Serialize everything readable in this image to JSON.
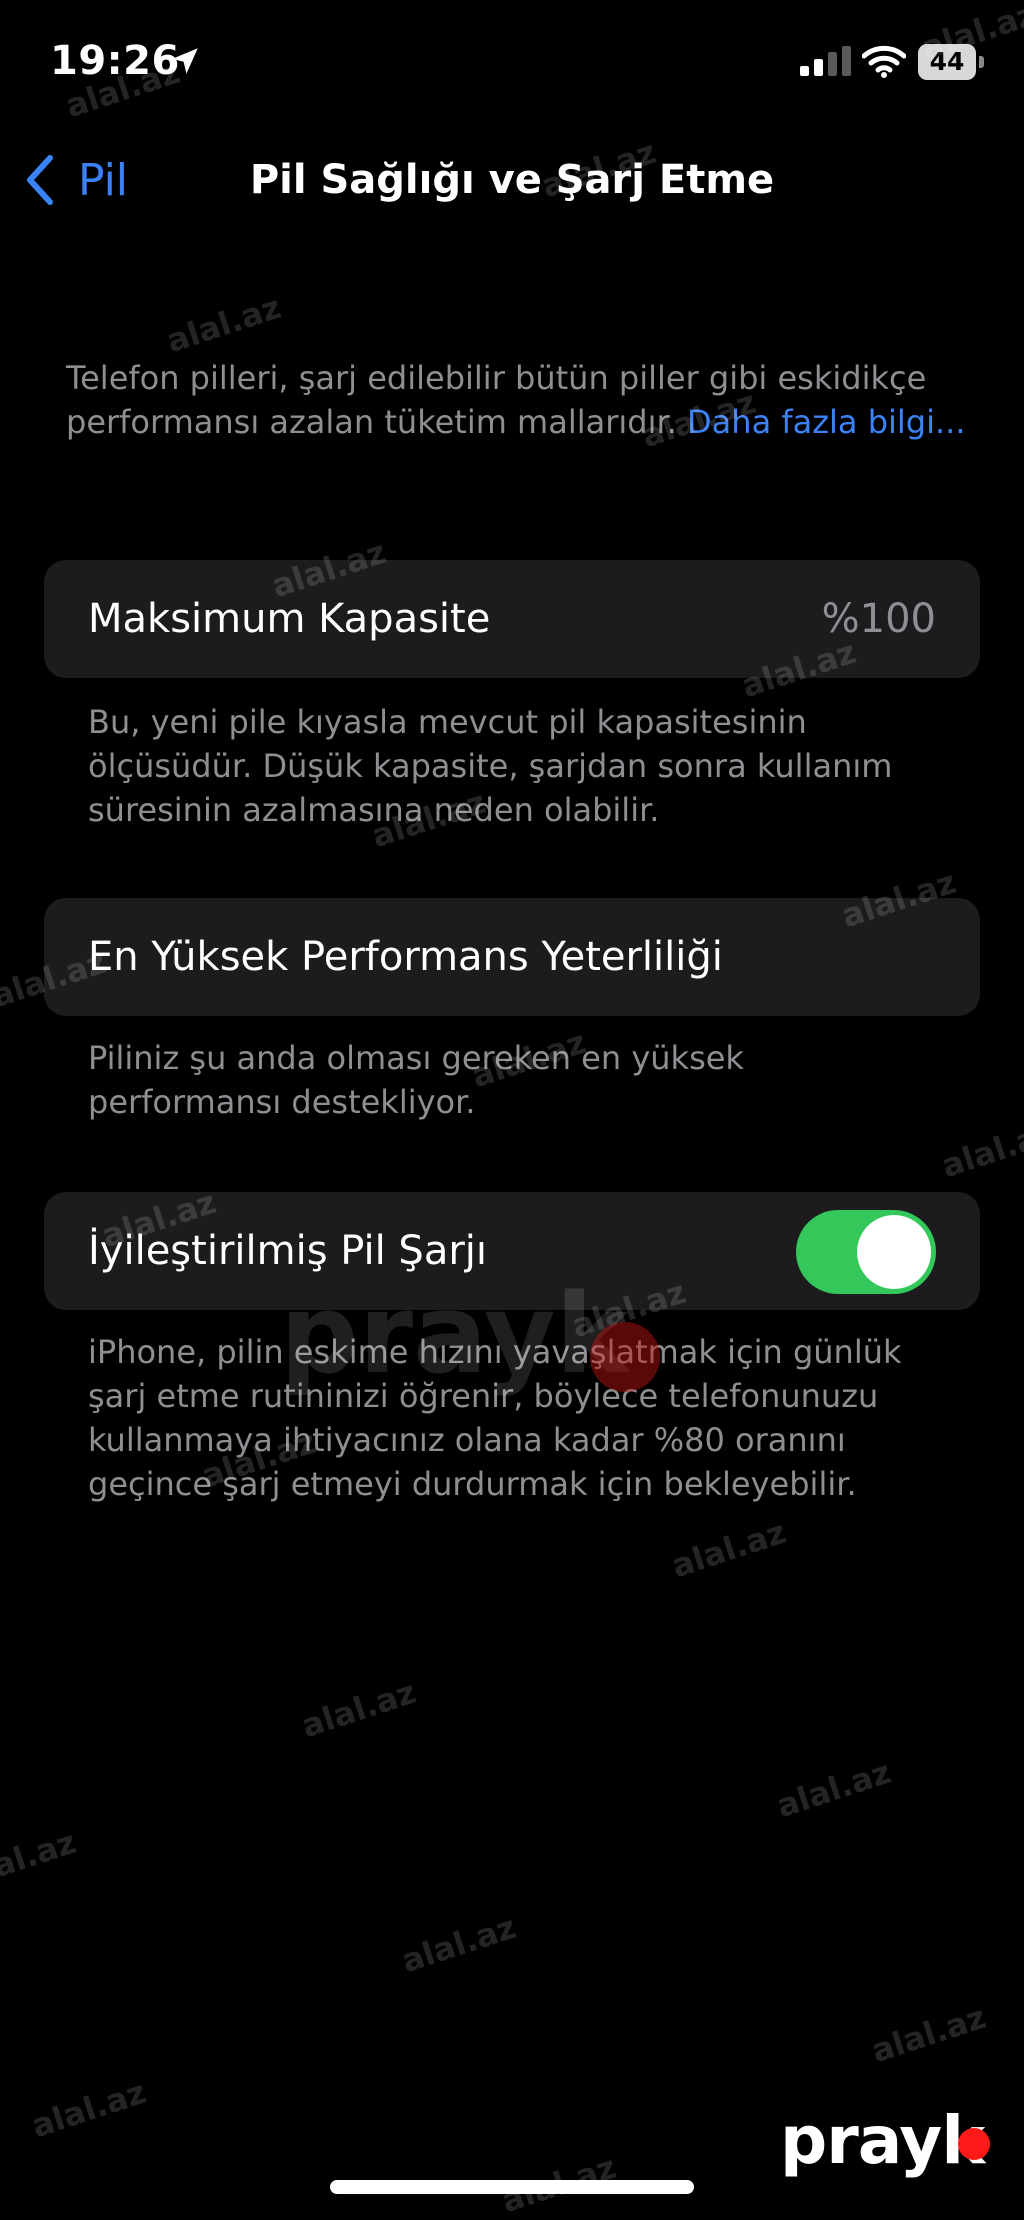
{
  "status_bar": {
    "time": "19:26",
    "battery": "44",
    "location_icon": "location-arrow-icon",
    "signal_icon": "cellular-signal-icon",
    "wifi_icon": "wifi-icon"
  },
  "nav": {
    "back_label": "Pil",
    "title": "Pil Sağlığı ve Şarj Etme"
  },
  "intro": {
    "text": "Telefon pilleri, şarj edilebilir bütün piller gibi eskidikçe performansı azalan tüketim mallarıdır. ",
    "link": "Daha fazla bilgi..."
  },
  "capacity": {
    "label": "Maksimum Kapasite",
    "value": "%100",
    "footer": "Bu, yeni pile kıyasla mevcut pil kapasitesinin ölçüsüdür. Düşük kapasite, şarjdan sonra kullanım süresinin azalmasına neden olabilir."
  },
  "performance": {
    "label": "En Yüksek Performans Yeterliliği",
    "footer": "Piliniz şu anda olması gereken en yüksek performansı destekliyor."
  },
  "optimized": {
    "label": "İyileştirilmiş Pil Şarjı",
    "enabled": true,
    "footer": "iPhone, pilin eskime hızını yavaşlatmak için günlük şarj etme rutininizi öğrenir, böylece telefonunuzu kullanmaya ihtiyacınız olana kadar %80 oranını geçince şarj etmeyi durdurmak için bekleyebilir."
  },
  "watermark": {
    "site": "alal.az",
    "brand": "prayk"
  },
  "colors": {
    "accent": "#3b82f6",
    "toggle_on": "#34c759",
    "cell_bg": "#1c1c1e",
    "secondary_text": "#8e8e93",
    "brand_dot": "#ff1a1a"
  }
}
